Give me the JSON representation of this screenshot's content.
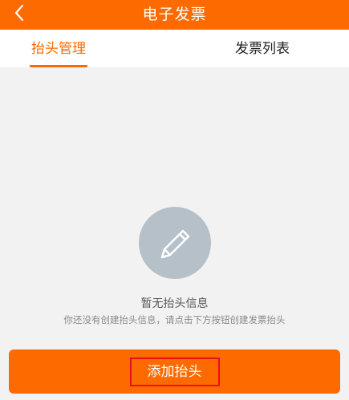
{
  "header": {
    "title": "电子发票",
    "back_icon": "chevron-left-icon",
    "background_color": "#fd6a00"
  },
  "tabs": [
    {
      "label": "抬头管理",
      "active": true
    },
    {
      "label": "发票列表",
      "active": false
    }
  ],
  "empty_state": {
    "icon": "pencil-icon",
    "title": "暂无抬头信息",
    "description": "你还没有创建抬头信息，请点击下方按钮创建发票抬头"
  },
  "footer": {
    "add_button_label": "添加抬头",
    "accent_color": "#fd6a00",
    "highlight_color": "#e8101a"
  }
}
